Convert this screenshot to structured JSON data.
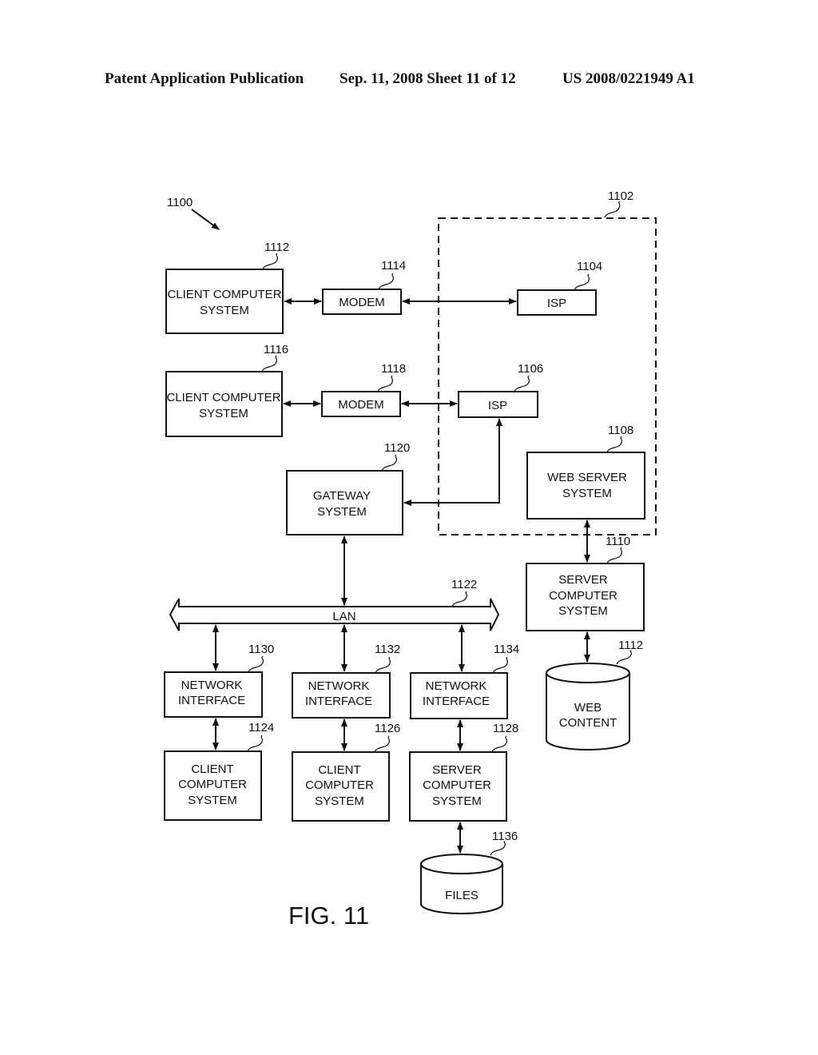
{
  "header": {
    "publication": "Patent Application Publication",
    "date_sheet": "Sep. 11, 2008   Sheet 11 of 12",
    "patent_number": "US 2008/0221949 A1"
  },
  "figure": {
    "caption": "FIG. 11",
    "ref": "1100",
    "internet_boundary_ref": "1102",
    "lan_label": "LAN",
    "lan_ref": "1122"
  },
  "nodes": {
    "client_1112": {
      "ref": "1112",
      "lines": [
        "CLIENT COMPUTER",
        "SYSTEM"
      ]
    },
    "modem_1114": {
      "ref": "1114",
      "lines": [
        "MODEM"
      ]
    },
    "isp_1104": {
      "ref": "1104",
      "lines": [
        "ISP"
      ]
    },
    "client_1116": {
      "ref": "1116",
      "lines": [
        "CLIENT COMPUTER",
        "SYSTEM"
      ]
    },
    "modem_1118": {
      "ref": "1118",
      "lines": [
        "MODEM"
      ]
    },
    "isp_1106": {
      "ref": "1106",
      "lines": [
        "ISP"
      ]
    },
    "webserver_1108": {
      "ref": "1108",
      "lines": [
        "WEB SERVER",
        "SYSTEM"
      ]
    },
    "gateway_1120": {
      "ref": "1120",
      "lines": [
        "GATEWAY",
        "SYSTEM"
      ]
    },
    "server_1110": {
      "ref": "1110",
      "lines": [
        "SERVER",
        "COMPUTER",
        "SYSTEM"
      ]
    },
    "webcontent_1112": {
      "ref": "1112",
      "lines": [
        "WEB",
        "CONTENT"
      ]
    },
    "netif_1130": {
      "ref": "1130",
      "lines": [
        "NETWORK",
        "INTERFACE"
      ]
    },
    "netif_1132": {
      "ref": "1132",
      "lines": [
        "NETWORK",
        "INTERFACE"
      ]
    },
    "netif_1134": {
      "ref": "1134",
      "lines": [
        "NETWORK",
        "INTERFACE"
      ]
    },
    "client_1124": {
      "ref": "1124",
      "lines": [
        "CLIENT",
        "COMPUTER",
        "SYSTEM"
      ]
    },
    "client_1126": {
      "ref": "1126",
      "lines": [
        "CLIENT",
        "COMPUTER",
        "SYSTEM"
      ]
    },
    "server_1128": {
      "ref": "1128",
      "lines": [
        "SERVER",
        "COMPUTER",
        "SYSTEM"
      ]
    },
    "files_1136": {
      "ref": "1136",
      "lines": [
        "FILES"
      ]
    }
  }
}
